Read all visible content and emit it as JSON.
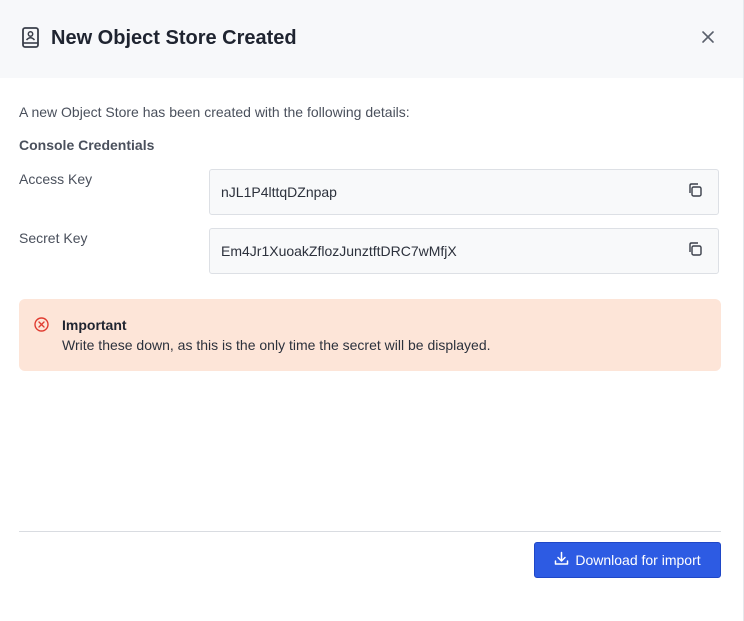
{
  "dialog": {
    "title": "New Object Store Created",
    "icon": "contact-book-icon",
    "close_icon": "close-icon"
  },
  "content": {
    "intro": "A new Object Store has been created with the following details:",
    "section_title": "Console Credentials",
    "fields": [
      {
        "label": "Access Key",
        "value": "nJL1P4lttqDZnpap",
        "action_icon": "copy-icon"
      },
      {
        "label": "Secret Key",
        "value": "Em4Jr1XuoakZflozJunztftDRC7wMfjX",
        "action_icon": "copy-icon"
      }
    ]
  },
  "alert": {
    "icon": "error-circle-icon",
    "title": "Important",
    "message": "Write these down, as this is the only time the secret will be displayed.",
    "background": "#fde5d8",
    "icon_color": "#e03c31"
  },
  "footer": {
    "download_label": "Download for import",
    "download_icon": "download-icon",
    "accent": "#2d5be3"
  }
}
